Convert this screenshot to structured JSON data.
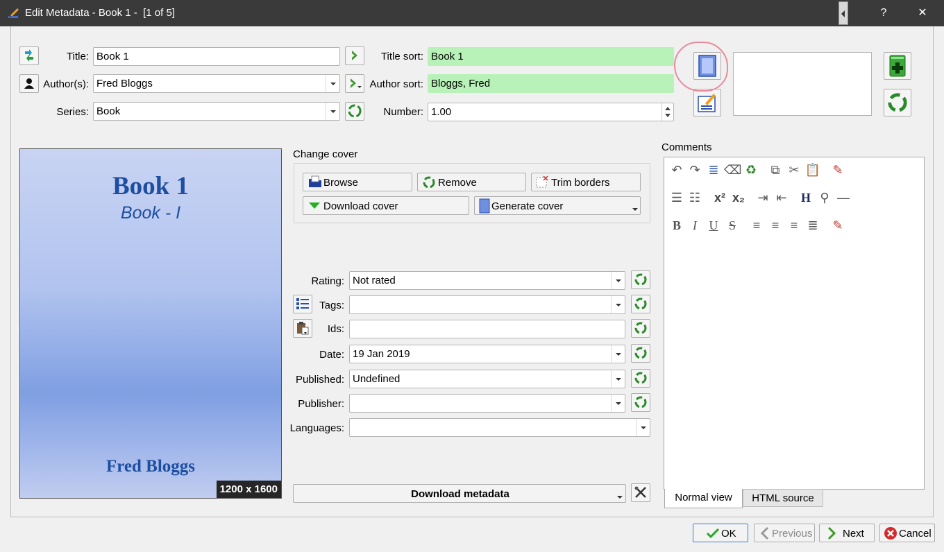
{
  "window": {
    "title": "Edit Metadata - Book 1 -  [1 of 5]",
    "help_glyph": "?",
    "close_glyph": "✕"
  },
  "fields": {
    "title_label": "Title:",
    "title_value": "Book 1",
    "title_sort_label": "Title sort:",
    "title_sort_value": "Book 1",
    "authors_label": "Author(s):",
    "authors_value": "Fred Bloggs",
    "author_sort_label": "Author sort:",
    "author_sort_value": "Bloggs, Fred",
    "series_label": "Series:",
    "series_value": "Book",
    "number_label": "Number:",
    "number_value": "1.00"
  },
  "cover": {
    "title": "Book 1",
    "series": "Book - I",
    "author": "Fred Bloggs",
    "size": "1200 x 1600"
  },
  "change_cover": {
    "heading": "Change cover",
    "browse": "Browse",
    "remove": "Remove",
    "trim": "Trim borders",
    "download": "Download cover",
    "generate": "Generate cover"
  },
  "meta": {
    "rating_label": "Rating:",
    "rating_value": "Not rated",
    "tags_label": "Tags:",
    "tags_value": "",
    "ids_label": "Ids:",
    "ids_value": "",
    "date_label": "Date:",
    "date_value": "19 Jan 2019",
    "published_label": "Published:",
    "published_value": "Undefined",
    "publisher_label": "Publisher:",
    "publisher_value": "",
    "languages_label": "Languages:",
    "languages_value": "",
    "download_metadata": "Download metadata"
  },
  "comments": {
    "label": "Comments",
    "tab_normal": "Normal view",
    "tab_html": "HTML source"
  },
  "footer": {
    "ok": "OK",
    "previous": "Previous",
    "next": "Next",
    "cancel": "Cancel"
  },
  "colors": {
    "titlebar": "#3a3a3a",
    "sort_field_bg": "#b8f2b8",
    "cover_text": "#1e4ea0",
    "recycle_green": "#2a8a2a",
    "annotation_circle": "#e98a9c"
  }
}
